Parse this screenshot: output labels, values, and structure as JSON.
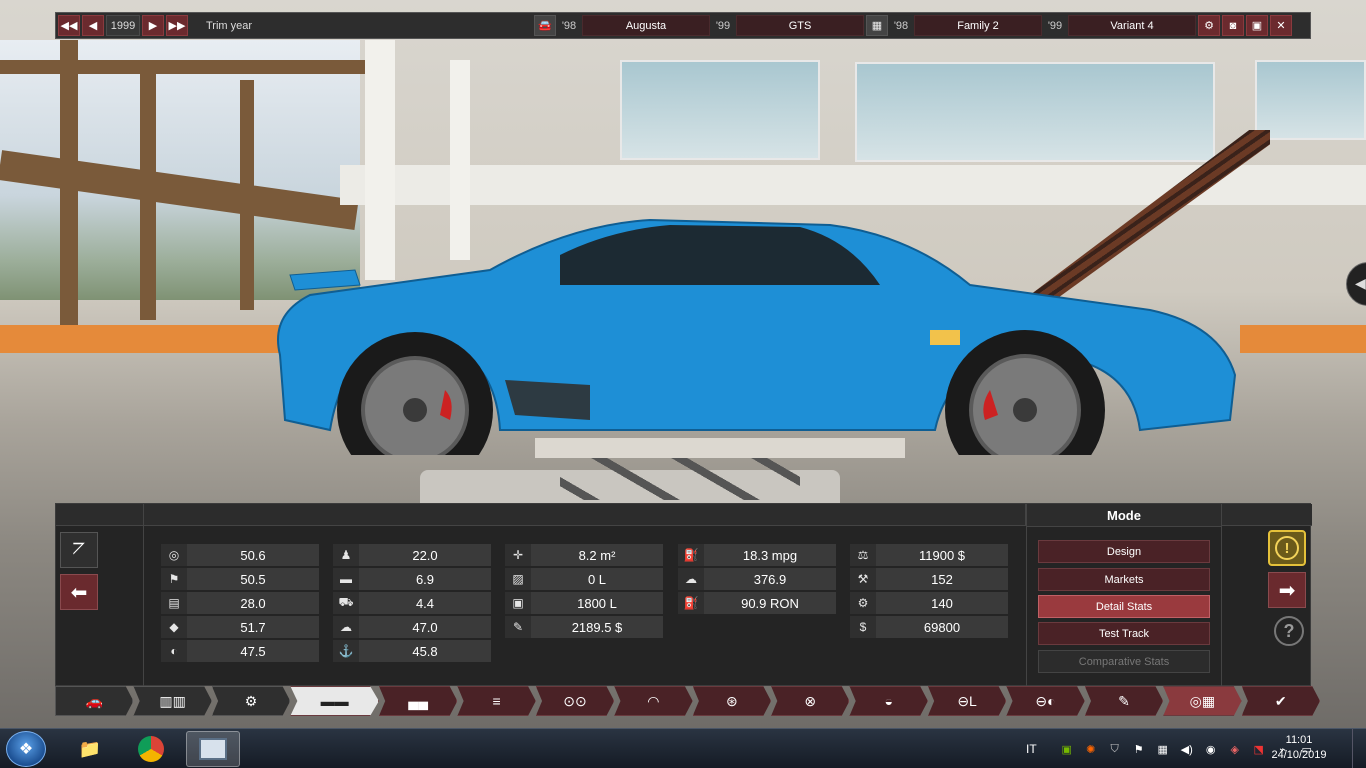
{
  "topbar": {
    "year": "1999",
    "trim_year_label": "Trim year",
    "model_year": "'98",
    "model_name": "Augusta",
    "trim_year_short": "'99",
    "trim_name": "GTS",
    "engine_year": "'98",
    "engine_family": "Family 2",
    "variant_year": "'99",
    "variant_name": "Variant 4"
  },
  "stats": {
    "col1": [
      {
        "icon": "steering-wheel-icon",
        "glyph": "◎",
        "value": "50.6"
      },
      {
        "icon": "checkered-flag-icon",
        "glyph": "⚑",
        "value": "50.5"
      },
      {
        "icon": "seat-icon",
        "glyph": "▤",
        "value": "28.0"
      },
      {
        "icon": "diamond-icon",
        "glyph": "◆",
        "value": "51.7"
      },
      {
        "icon": "safety-icon",
        "glyph": "◐",
        "value": "47.5"
      }
    ],
    "col2": [
      {
        "icon": "passengers-icon",
        "glyph": "♟",
        "value": "22.0"
      },
      {
        "icon": "utility-icon",
        "glyph": "▬",
        "value": "6.9"
      },
      {
        "icon": "offroad-icon",
        "glyph": "⛟",
        "value": "4.4"
      },
      {
        "icon": "reliability-icon",
        "glyph": "☁",
        "value": "47.0"
      },
      {
        "icon": "environment-icon",
        "glyph": "⚓",
        "value": "45.8"
      }
    ],
    "col3": [
      {
        "icon": "frontal-area-icon",
        "glyph": "✛",
        "value": "8.2 m²"
      },
      {
        "icon": "cargo-volume-icon",
        "glyph": "▨",
        "value": "0 L"
      },
      {
        "icon": "passenger-volume-icon",
        "glyph": "▣",
        "value": "1800 L"
      },
      {
        "icon": "service-cost-icon",
        "glyph": "✎",
        "value": "2189.5 $"
      }
    ],
    "col4": [
      {
        "icon": "fuel-economy-icon",
        "glyph": "⛽",
        "value": "18.3 mpg"
      },
      {
        "icon": "emissions-icon",
        "glyph": "☁",
        "value": "376.9"
      },
      {
        "icon": "fuel-octane-icon",
        "glyph": "⛽",
        "value": "90.9 RON"
      }
    ],
    "col5": [
      {
        "icon": "material-cost-icon",
        "glyph": "⚖",
        "value": "11900 $"
      },
      {
        "icon": "tooling-cost-icon",
        "glyph": "⚒",
        "value": "152"
      },
      {
        "icon": "man-hours-icon",
        "glyph": "⚙",
        "value": "140"
      },
      {
        "icon": "cost-icon",
        "glyph": "$",
        "value": "69800"
      }
    ]
  },
  "mode": {
    "title": "Mode",
    "buttons": [
      "Design",
      "Markets",
      "Detail Stats",
      "Test Track",
      "Comparative Stats"
    ],
    "active": "Detail Stats"
  },
  "taskbar": {
    "lang": "IT",
    "time": "11:01",
    "date": "24/10/2019"
  },
  "colors": {
    "accent": "#6b2a2e",
    "active_mode": "#9a3a3e",
    "car_body": "#1e8fd6"
  }
}
